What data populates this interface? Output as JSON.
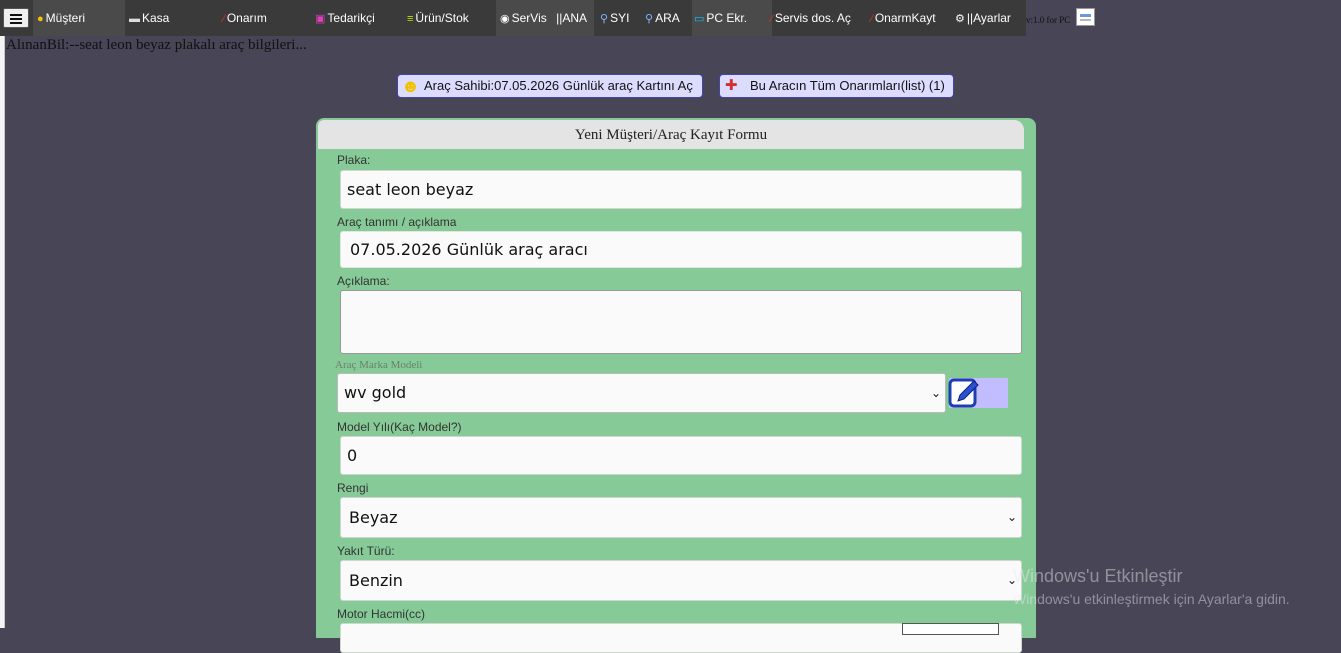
{
  "nav": {
    "items": [
      {
        "label": "Müşteri",
        "icon": "person-icon"
      },
      {
        "label": "Kasa",
        "icon": "cash-register-icon"
      },
      {
        "label": "Onarım",
        "icon": "wrench-icon"
      },
      {
        "label": "Tedarikçi",
        "icon": "supplier-icon"
      },
      {
        "label": "Ürün/Stok",
        "icon": "cart-icon"
      },
      {
        "label": "SerVis",
        "icon": "service-icon"
      },
      {
        "label": "||ANA",
        "icon": ""
      },
      {
        "label": "SYI",
        "icon": "search-icon"
      },
      {
        "label": "ARA",
        "icon": "search-icon"
      },
      {
        "label": "PC Ekr.",
        "icon": "monitor-icon"
      },
      {
        "label": "Servis dos. Aç",
        "icon": "wrench-icon"
      },
      {
        "label": "OnarmKayt",
        "icon": "wrench-icon"
      },
      {
        "label": "||Ayarlar",
        "icon": "gear-icon"
      }
    ],
    "version": "v:1.0 for PC"
  },
  "info_line": "AlınanBil:--seat leon beyaz plakalı araç bilgileri...",
  "actions": {
    "owner_card": "Araç Sahibi:07.05.2026 Günlük araç Kartını Aç",
    "all_repairs": "Bu Aracın Tüm Onarımları(list) (1)"
  },
  "form": {
    "title": "Yeni Müşteri/Araç Kayıt Formu",
    "plaka_label": "Plaka:",
    "plaka_value": "seat leon beyaz",
    "tanim_label": "Araç tanımı / açıklama",
    "tanim_value": "07.05.2026 Günlük araç aracı",
    "aciklama_label": "Açıklama:",
    "aciklama_value": "",
    "marka_label": "Araç Marka Modeli",
    "marka_value": "wv gold",
    "model_yili_label": "Model Yılı(Kaç Model?)",
    "model_yili_value": "0",
    "renk_label": "Rengi",
    "renk_value": "Beyaz",
    "yakit_label": "Yakıt Türü:",
    "yakit_value": "Benzin",
    "motor_label": "Motor Hacmi(cc)"
  },
  "watermark": {
    "line1": "Windows'u Etkinleştir",
    "line2": "Windows'u etkinleştirmek için Ayarlar'a gidin."
  },
  "colors": {
    "background": "#474556",
    "form": "#86cb97",
    "button": "#dcdcff",
    "accent": "#4444aa"
  }
}
